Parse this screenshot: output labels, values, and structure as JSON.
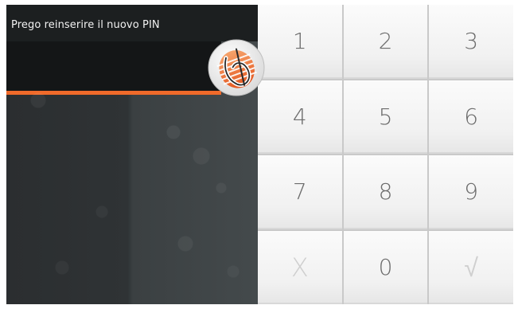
{
  "prompt": {
    "text": "Prego reinserire il nuovo PIN"
  },
  "pin": {
    "value": ""
  },
  "colors": {
    "accent": "#f06a2a",
    "panel": "#2f3335",
    "key_text": "#6c6c6c"
  },
  "keypad": {
    "keys": [
      "1",
      "2",
      "3",
      "4",
      "5",
      "6",
      "7",
      "8",
      "9",
      "X",
      "0",
      "√"
    ],
    "icons": {
      "cancel": "cancel-icon",
      "confirm": "checkmark-icon",
      "logo": "brand-logo-icon"
    }
  }
}
